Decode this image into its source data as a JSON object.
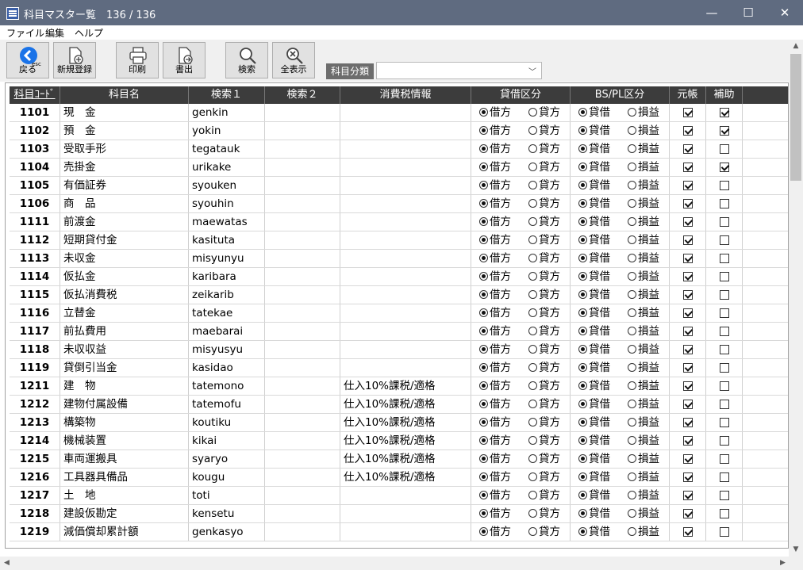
{
  "window": {
    "title": "科目マスター覧",
    "count": "136 / 136",
    "minimize": "—",
    "maximize": "☐",
    "close": "✕"
  },
  "menu": [
    "ファイル",
    "編集",
    "ヘルプ"
  ],
  "toolbar": {
    "back": "戻る",
    "back_sub": "esc",
    "new": "新規登録",
    "print": "印刷",
    "export": "書出",
    "search": "検索",
    "show_all": "全表示"
  },
  "category": {
    "label": "科目分類",
    "value": ""
  },
  "columns": [
    "科目ｺｰﾄﾞ",
    "科目名",
    "検索１",
    "検索２",
    "消費税情報",
    "貸借区分",
    "BS/PL区分",
    "元帳",
    "補助"
  ],
  "labels": {
    "debit": "借方",
    "credit": "貸方",
    "bs": "貸借",
    "pl": "損益"
  },
  "rows": [
    {
      "code": "1101",
      "name": "現　金",
      "s1": "genkin",
      "s2": "",
      "tax": "",
      "side": "debit",
      "bspl": "bs",
      "ledger": true,
      "sub": true
    },
    {
      "code": "1102",
      "name": "預　金",
      "s1": "yokin",
      "s2": "",
      "tax": "",
      "side": "debit",
      "bspl": "bs",
      "ledger": true,
      "sub": true
    },
    {
      "code": "1103",
      "name": "受取手形",
      "s1": "tegatauk",
      "s2": "",
      "tax": "",
      "side": "debit",
      "bspl": "bs",
      "ledger": true,
      "sub": false
    },
    {
      "code": "1104",
      "name": "売掛金",
      "s1": "urikake",
      "s2": "",
      "tax": "",
      "side": "debit",
      "bspl": "bs",
      "ledger": true,
      "sub": true
    },
    {
      "code": "1105",
      "name": "有価証券",
      "s1": "syouken",
      "s2": "",
      "tax": "",
      "side": "debit",
      "bspl": "bs",
      "ledger": true,
      "sub": false
    },
    {
      "code": "1106",
      "name": "商　品",
      "s1": "syouhin",
      "s2": "",
      "tax": "",
      "side": "debit",
      "bspl": "bs",
      "ledger": true,
      "sub": false
    },
    {
      "code": "1111",
      "name": "前渡金",
      "s1": "maewatas",
      "s2": "",
      "tax": "",
      "side": "debit",
      "bspl": "bs",
      "ledger": true,
      "sub": false
    },
    {
      "code": "1112",
      "name": "短期貸付金",
      "s1": "kasituta",
      "s2": "",
      "tax": "",
      "side": "debit",
      "bspl": "bs",
      "ledger": true,
      "sub": false
    },
    {
      "code": "1113",
      "name": "未収金",
      "s1": "misyunyu",
      "s2": "",
      "tax": "",
      "side": "debit",
      "bspl": "bs",
      "ledger": true,
      "sub": false
    },
    {
      "code": "1114",
      "name": "仮払金",
      "s1": "karibara",
      "s2": "",
      "tax": "",
      "side": "debit",
      "bspl": "bs",
      "ledger": true,
      "sub": false
    },
    {
      "code": "1115",
      "name": "仮払消費税",
      "s1": "zeikarib",
      "s2": "",
      "tax": "",
      "side": "debit",
      "bspl": "bs",
      "ledger": true,
      "sub": false
    },
    {
      "code": "1116",
      "name": "立替金",
      "s1": "tatekae",
      "s2": "",
      "tax": "",
      "side": "debit",
      "bspl": "bs",
      "ledger": true,
      "sub": false
    },
    {
      "code": "1117",
      "name": "前払費用",
      "s1": "maebarai",
      "s2": "",
      "tax": "",
      "side": "debit",
      "bspl": "bs",
      "ledger": true,
      "sub": false
    },
    {
      "code": "1118",
      "name": "未収収益",
      "s1": "misyusyu",
      "s2": "",
      "tax": "",
      "side": "debit",
      "bspl": "bs",
      "ledger": true,
      "sub": false
    },
    {
      "code": "1119",
      "name": "貸倒引当金",
      "s1": "kasidao",
      "s2": "",
      "tax": "",
      "side": "debit",
      "bspl": "bs",
      "ledger": true,
      "sub": false
    },
    {
      "code": "1211",
      "name": "建　物",
      "s1": "tatemono",
      "s2": "",
      "tax": "仕入10%課税/適格",
      "side": "debit",
      "bspl": "bs",
      "ledger": true,
      "sub": false
    },
    {
      "code": "1212",
      "name": "建物付属設備",
      "s1": "tatemofu",
      "s2": "",
      "tax": "仕入10%課税/適格",
      "side": "debit",
      "bspl": "bs",
      "ledger": true,
      "sub": false
    },
    {
      "code": "1213",
      "name": "構築物",
      "s1": "koutiku",
      "s2": "",
      "tax": "仕入10%課税/適格",
      "side": "debit",
      "bspl": "bs",
      "ledger": true,
      "sub": false
    },
    {
      "code": "1214",
      "name": "機械装置",
      "s1": "kikai",
      "s2": "",
      "tax": "仕入10%課税/適格",
      "side": "debit",
      "bspl": "bs",
      "ledger": true,
      "sub": false
    },
    {
      "code": "1215",
      "name": "車両運搬具",
      "s1": "syaryo",
      "s2": "",
      "tax": "仕入10%課税/適格",
      "side": "debit",
      "bspl": "bs",
      "ledger": true,
      "sub": false
    },
    {
      "code": "1216",
      "name": "工具器具備品",
      "s1": "kougu",
      "s2": "",
      "tax": "仕入10%課税/適格",
      "side": "debit",
      "bspl": "bs",
      "ledger": true,
      "sub": false
    },
    {
      "code": "1217",
      "name": "土　地",
      "s1": "toti",
      "s2": "",
      "tax": "",
      "side": "debit",
      "bspl": "bs",
      "ledger": true,
      "sub": false
    },
    {
      "code": "1218",
      "name": "建設仮勘定",
      "s1": "kensetu",
      "s2": "",
      "tax": "",
      "side": "debit",
      "bspl": "bs",
      "ledger": true,
      "sub": false
    },
    {
      "code": "1219",
      "name": "減価償却累計額",
      "s1": "genkasyo",
      "s2": "",
      "tax": "",
      "side": "debit",
      "bspl": "bs",
      "ledger": true,
      "sub": false
    }
  ]
}
